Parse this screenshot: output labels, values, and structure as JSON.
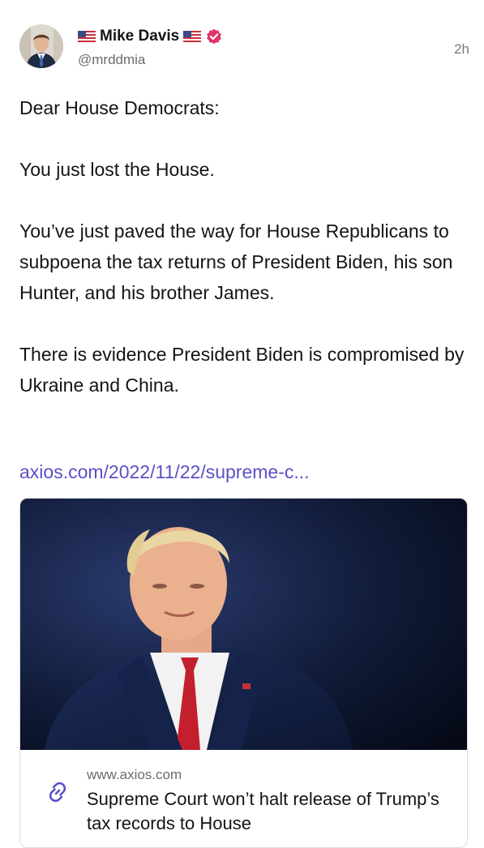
{
  "post": {
    "author": {
      "name": "Mike Davis",
      "handle": "@mrddmia",
      "flag_icon": "us-flag-icon",
      "verified_icon": "verified-badge-icon"
    },
    "timestamp": "2h",
    "paragraphs": [
      "Dear House Democrats:",
      "You just lost the House.",
      "You’ve just paved the way for House Republicans to subpoena the tax returns of President Biden, his son Hunter, and his brother James.",
      "There is evidence President Biden is compromised by Ukraine and China."
    ],
    "link_text": "axios.com/2022/11/22/supreme-c...",
    "card": {
      "domain": "www.axios.com",
      "title": "Supreme Court won’t halt release of Trump’s tax records to House",
      "link_icon": "link-icon"
    }
  },
  "colors": {
    "link": "#5b50c7",
    "verified_badge": "#e0346a",
    "secondary_text": "#6b6b6b"
  }
}
